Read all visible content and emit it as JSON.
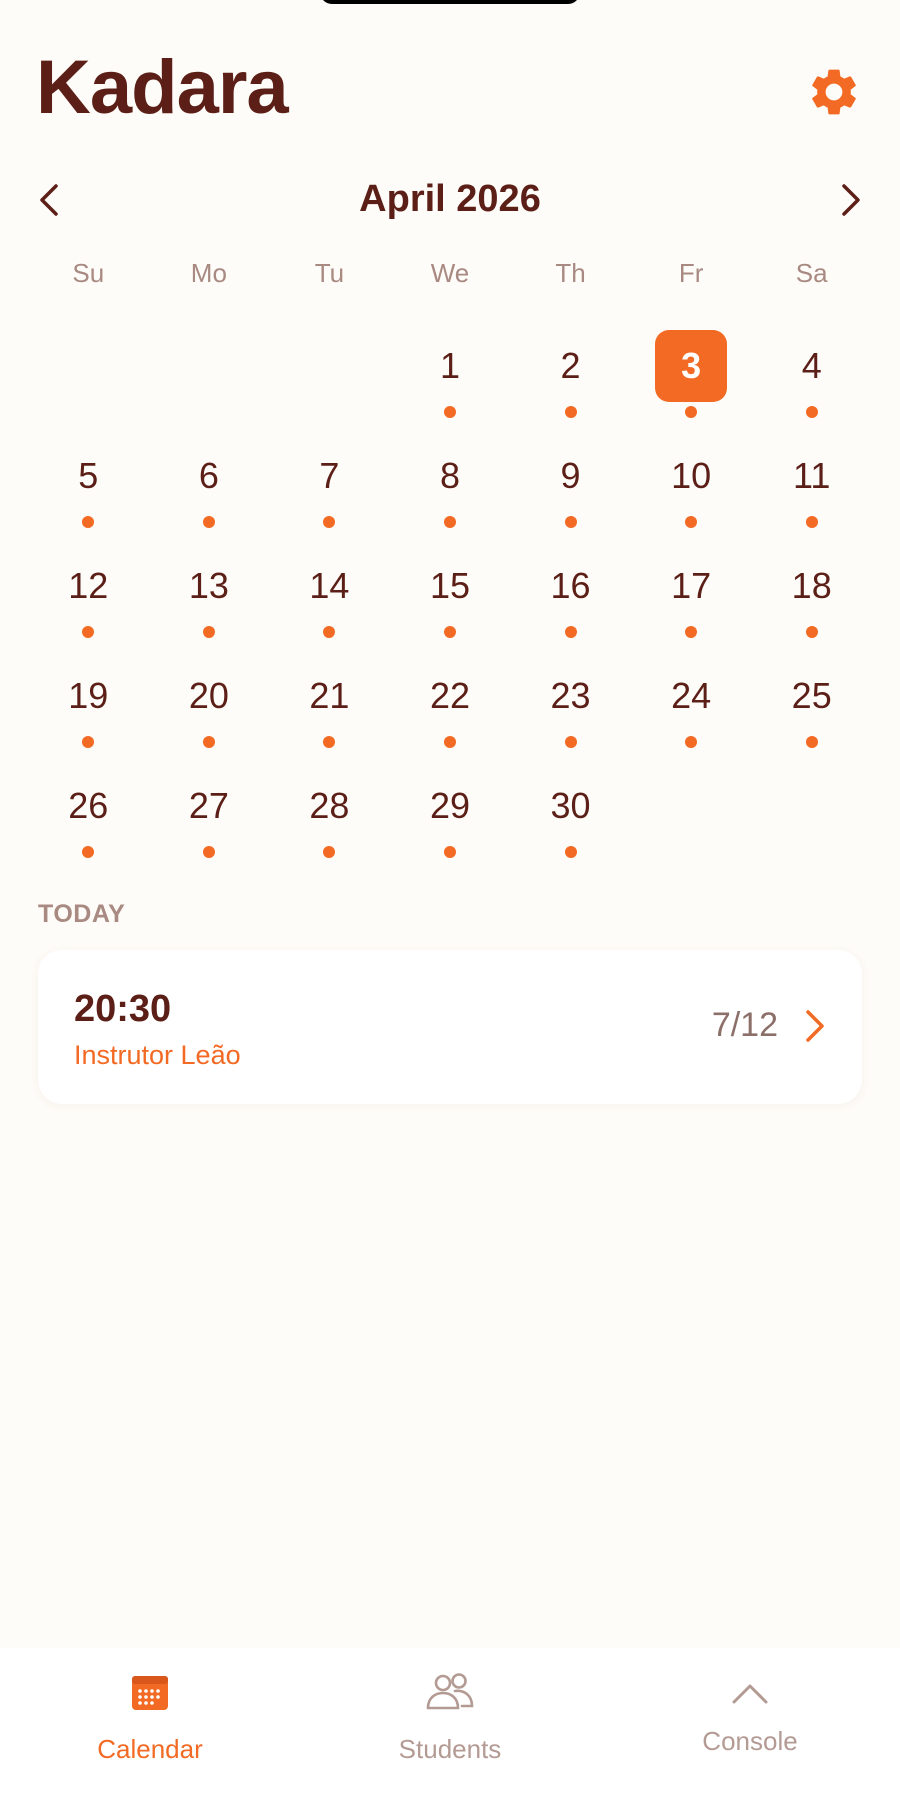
{
  "app": {
    "title": "Kadara"
  },
  "colors": {
    "accent": "#F26A23",
    "text_primary": "#5B1F17",
    "text_muted": "#A98A82",
    "background": "#FEFCF8",
    "card": "#FFFFFF"
  },
  "calendar": {
    "month_label": "April 2026",
    "prev_icon": "chevron-left-icon",
    "next_icon": "chevron-right-icon",
    "weekdays": [
      "Su",
      "Mo",
      "Tu",
      "We",
      "Th",
      "Fr",
      "Sa"
    ],
    "first_weekday_index": 3,
    "days_in_month": 30,
    "selected_day": 3,
    "days_with_events": [
      1,
      2,
      3,
      4,
      5,
      6,
      7,
      8,
      9,
      10,
      11,
      12,
      13,
      14,
      15,
      16,
      17,
      18,
      19,
      20,
      21,
      22,
      23,
      24,
      25,
      26,
      27,
      28,
      29,
      30
    ]
  },
  "today": {
    "section_label": "TODAY",
    "classes": [
      {
        "time": "20:30",
        "instructor": "Instrutor Leão",
        "count": "7/12"
      }
    ]
  },
  "tabbar": {
    "tabs": [
      {
        "label": "Calendar",
        "icon": "calendar-icon",
        "active": true
      },
      {
        "label": "Students",
        "icon": "users-icon",
        "active": false
      },
      {
        "label": "Console",
        "icon": "chevron-up-icon",
        "active": false
      }
    ]
  }
}
